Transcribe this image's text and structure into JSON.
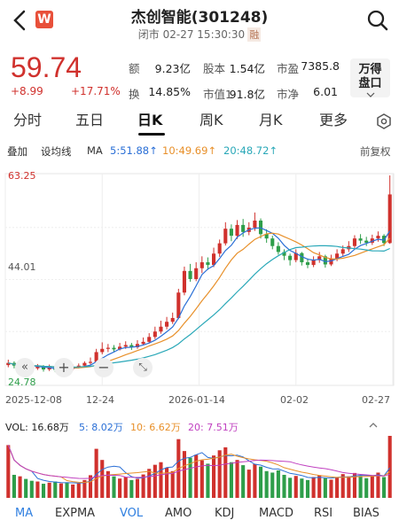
{
  "header": {
    "back_label": "<",
    "logo_text": "W",
    "title": "杰创智能(301248)",
    "status": "闭市 02-27 15:30:30",
    "margin_badge": "融"
  },
  "quote": {
    "price": "59.74",
    "change": "+8.99",
    "change_pct": "+17.71%",
    "fields": [
      {
        "label": "额",
        "value": "9.23亿"
      },
      {
        "label": "股本",
        "value": "1.54亿"
      },
      {
        "label": "市盈",
        "value": "7385.8"
      },
      {
        "label": "换",
        "value": "14.85%"
      },
      {
        "label": "市值1",
        "value": "91.8亿"
      },
      {
        "label": "市净",
        "value": "6.01"
      }
    ],
    "wande_line1": "万得",
    "wande_line2": "盘口"
  },
  "tabs": [
    "分时",
    "五日",
    "日K",
    "周K",
    "月K",
    "更多"
  ],
  "active_tab": "日K",
  "toolbar": {
    "overlay": "叠加",
    "set_ma": "设均线",
    "ma_label": "MA",
    "ma5": "5:51.88↑",
    "ma10": "10:49.69↑",
    "ma20": "20:48.72↑",
    "adjust": "前复权"
  },
  "colors": {
    "up": "#d0312d",
    "down": "#2e9e4a",
    "ma5": "#2a6fd6",
    "ma10": "#e8902a",
    "ma20": "#2aa8b8",
    "vol_ma10": "#e8902a",
    "vol_ma20": "#c040c0"
  },
  "chart_data": {
    "type": "candlestick",
    "y_high_label": "63.25",
    "y_mid_label": "44.01",
    "y_low_label": "24.78",
    "ylim": [
      24.78,
      63.25
    ],
    "x_labels": [
      "2025-12-08",
      "12-24",
      "2026-01-14",
      "02-02",
      "02-27"
    ],
    "candles": [
      [
        28.2,
        28.6,
        29.2,
        27.8
      ],
      [
        28.6,
        28.1,
        28.9,
        27.6
      ],
      [
        28.1,
        28.3,
        28.8,
        27.7
      ],
      [
        28.3,
        27.9,
        28.7,
        27.5
      ],
      [
        27.9,
        27.6,
        28.3,
        27.2
      ],
      [
        27.6,
        27.9,
        28.4,
        27.3
      ],
      [
        27.9,
        27.4,
        28.2,
        27.0
      ],
      [
        27.4,
        27.8,
        28.3,
        27.1
      ],
      [
        27.8,
        27.3,
        28.1,
        26.9
      ],
      [
        27.3,
        27.7,
        28.0,
        27.0
      ],
      [
        27.7,
        27.5,
        28.1,
        27.1
      ],
      [
        27.5,
        27.9,
        28.3,
        27.2
      ],
      [
        27.9,
        28.1,
        28.5,
        27.6
      ],
      [
        28.1,
        28.6,
        28.9,
        27.8
      ],
      [
        28.6,
        28.8,
        29.6,
        28.3
      ],
      [
        28.8,
        30.6,
        31.2,
        28.6
      ],
      [
        30.6,
        31.2,
        32.4,
        30.2
      ],
      [
        31.2,
        31.4,
        32.1,
        30.6
      ],
      [
        31.4,
        31.1,
        31.9,
        30.6
      ],
      [
        31.1,
        31.6,
        32.3,
        30.9
      ],
      [
        31.6,
        31.9,
        32.6,
        31.2
      ],
      [
        31.9,
        31.5,
        32.3,
        31.0
      ],
      [
        31.5,
        32.1,
        32.8,
        31.2
      ],
      [
        32.1,
        32.5,
        33.3,
        31.9
      ],
      [
        32.5,
        33.4,
        34.1,
        32.2
      ],
      [
        33.4,
        34.4,
        35.3,
        33.0
      ],
      [
        34.4,
        35.3,
        36.4,
        34.0
      ],
      [
        35.3,
        36.2,
        37.1,
        34.8
      ],
      [
        36.2,
        36.9,
        37.9,
        35.8
      ],
      [
        36.9,
        41.6,
        42.3,
        36.7
      ],
      [
        41.6,
        45.6,
        46.4,
        41.1
      ],
      [
        45.6,
        44.1,
        46.9,
        43.6
      ],
      [
        44.1,
        46.1,
        47.2,
        43.7
      ],
      [
        46.1,
        47.2,
        48.3,
        45.2
      ],
      [
        47.2,
        46.7,
        48.1,
        45.8
      ],
      [
        46.7,
        48.8,
        49.9,
        46.3
      ],
      [
        48.8,
        50.7,
        51.4,
        48.2
      ],
      [
        50.7,
        53.4,
        54.6,
        50.3
      ],
      [
        53.4,
        52.1,
        54.2,
        51.1
      ],
      [
        52.1,
        54.1,
        55.0,
        51.5
      ],
      [
        54.1,
        52.8,
        55.2,
        51.9
      ],
      [
        52.8,
        53.6,
        54.6,
        52.2
      ],
      [
        53.6,
        54.9,
        56.4,
        53.0
      ],
      [
        54.9,
        52.4,
        55.3,
        51.6
      ],
      [
        52.4,
        51.6,
        53.3,
        50.8
      ],
      [
        51.6,
        50.2,
        52.1,
        49.6
      ],
      [
        50.2,
        49.1,
        50.9,
        48.6
      ],
      [
        49.1,
        48.4,
        49.6,
        47.6
      ],
      [
        48.4,
        47.6,
        48.8,
        46.6
      ],
      [
        47.6,
        48.9,
        49.6,
        47.2
      ],
      [
        48.9,
        47.2,
        49.1,
        46.6
      ],
      [
        47.2,
        46.7,
        47.9,
        46.1
      ],
      [
        46.7,
        47.6,
        48.3,
        46.3
      ],
      [
        47.6,
        48.3,
        49.1,
        47.1
      ],
      [
        48.3,
        46.8,
        48.6,
        46.2
      ],
      [
        46.8,
        47.9,
        48.6,
        46.5
      ],
      [
        47.9,
        48.8,
        49.6,
        47.4
      ],
      [
        48.8,
        49.6,
        50.3,
        48.2
      ],
      [
        49.6,
        50.2,
        51.1,
        49.1
      ],
      [
        50.2,
        51.6,
        52.2,
        49.8
      ],
      [
        51.6,
        51.2,
        52.4,
        50.6
      ],
      [
        51.2,
        50.8,
        51.9,
        50.2
      ],
      [
        50.8,
        51.6,
        52.3,
        50.4
      ],
      [
        51.6,
        52.1,
        52.9,
        51.0
      ],
      [
        52.1,
        50.75,
        52.4,
        50.2
      ],
      [
        50.75,
        59.74,
        63.25,
        50.6
      ]
    ],
    "volume": {
      "label": "VOL: 16.68万",
      "ma5": "5: 8.02万",
      "ma10": "10: 6.62万",
      "ma20": "20: 7.51万",
      "ylim": [
        0,
        16.68
      ],
      "values": [
        14.2,
        6.2,
        5.8,
        5.1,
        4.6,
        4.4,
        3.8,
        4.1,
        4.4,
        3.9,
        4.2,
        3.6,
        3.9,
        4.8,
        6.1,
        13.2,
        10.2,
        7.2,
        5.8,
        5.2,
        5.6,
        4.8,
        5.1,
        6.3,
        7.8,
        8.9,
        9.6,
        8.1,
        7.2,
        15.8,
        12.6,
        10.8,
        11.6,
        10.1,
        9.2,
        11.4,
        12.8,
        13.6,
        9.6,
        10.2,
        8.8,
        7.6,
        9.1,
        8.4,
        7.2,
        6.8,
        7.4,
        6.2,
        5.4,
        5.9,
        5.2,
        4.8,
        5.6,
        6.1,
        5.3,
        4.9,
        5.6,
        6.4,
        5.8,
        6.7,
        5.9,
        5.3,
        6.1,
        6.8,
        5.6,
        16.68
      ]
    }
  },
  "bottom_tabs": [
    "MA",
    "EXPMA",
    "VOL",
    "AMO",
    "KDJ",
    "MACD",
    "RSI",
    "BIAS"
  ],
  "bottom_selected": [
    "MA",
    "VOL"
  ]
}
